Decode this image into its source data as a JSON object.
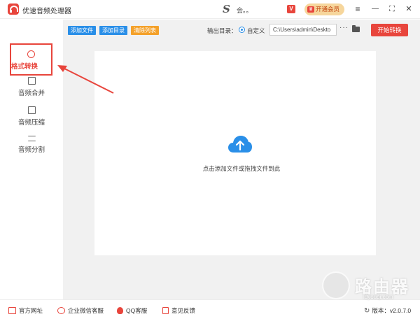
{
  "titlebar": {
    "app_title": "优速音频处理器",
    "user_name": "会。。",
    "vip_button": "开通会员",
    "minimize": "—",
    "maximize": "⛶",
    "close": "✕",
    "menu": "≡"
  },
  "sidebar": {
    "items": [
      {
        "label": "格式转换",
        "icon": "format-convert-icon",
        "active": true
      },
      {
        "label": "音频合并",
        "icon": "audio-merge-icon"
      },
      {
        "label": "音频压缩",
        "icon": "audio-compress-icon"
      },
      {
        "label": "音频分割",
        "icon": "audio-split-icon"
      }
    ]
  },
  "toolbar": {
    "add_file": "添加文件",
    "add_folder": "添加目录",
    "clear_list": "清除列表",
    "output_label": "输出目录：",
    "custom_label": "自定义",
    "output_path": "C:\\Users\\admin\\Deskto",
    "more": "···",
    "start": "开始转换"
  },
  "drop_area": {
    "hint": "点击添加文件或拖拽文件到此"
  },
  "footer": {
    "official_site": "官方网址",
    "wechat_service": "企业微信客服",
    "qq_service": "QQ客服",
    "feedback": "意见反馈",
    "version": "版本：v2.0.7.0"
  },
  "watermark": {
    "text": "路由器",
    "sub": "luyouqi.com"
  },
  "colors": {
    "accent_red": "#e8453c",
    "button_blue": "#2a8fe8",
    "button_orange": "#f4a12a",
    "main_bg": "#f1f1f1"
  }
}
